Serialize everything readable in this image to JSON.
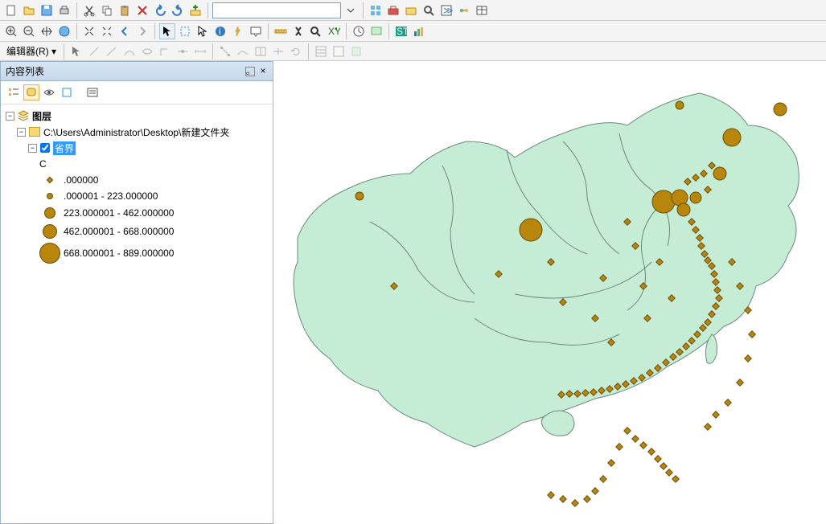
{
  "toolbar": {
    "scale_value": "",
    "editor_label": "编辑器(R)"
  },
  "toc": {
    "title": "内容列表",
    "root_label": "图层",
    "path_label": "C:\\Users\\Administrator\\Desktop\\新建文件夹",
    "layer_name": "省界",
    "field_label": "C",
    "legend": [
      {
        "label": ".000000",
        "shape": "diamond",
        "size": 6
      },
      {
        "label": ".000001 - 223.000000",
        "shape": "circle",
        "size": 8
      },
      {
        "label": "223.000001 - 462.000000",
        "shape": "circle",
        "size": 14
      },
      {
        "label": "462.000001 - 668.000000",
        "shape": "circle",
        "size": 18
      },
      {
        "label": "668.000001 - 889.000000",
        "shape": "circle",
        "size": 26
      }
    ]
  }
}
